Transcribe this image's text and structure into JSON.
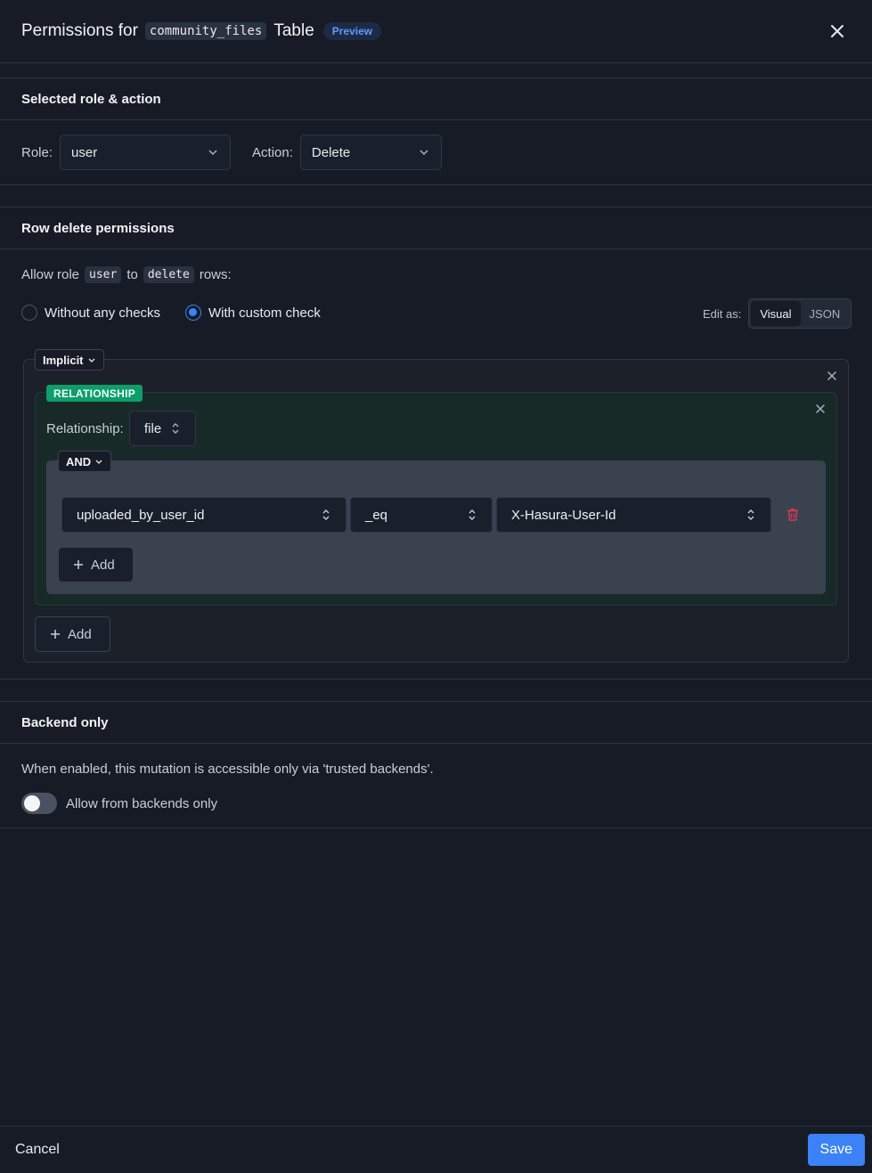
{
  "header": {
    "title_prefix": "Permissions for",
    "table_name": "community_files",
    "title_suffix": "Table",
    "badge": "Preview"
  },
  "role_section": {
    "title": "Selected role & action",
    "role_label": "Role:",
    "role_value": "user",
    "action_label": "Action:",
    "action_value": "Delete"
  },
  "row_section": {
    "title": "Row delete permissions",
    "allow_text_1": "Allow role",
    "allow_role": "user",
    "allow_text_2": "to",
    "allow_action": "delete",
    "allow_text_3": "rows:",
    "radio_no_checks": "Without any checks",
    "radio_custom": "With custom check",
    "selected_radio": "With custom check",
    "edit_as_label": "Edit as:",
    "edit_options": [
      "Visual",
      "JSON"
    ],
    "edit_selected": "Visual",
    "implicit_label": "Implicit",
    "relationship_badge": "RELATIONSHIP",
    "relationship_label": "Relationship:",
    "relationship_value": "file",
    "and_label": "AND",
    "condition": {
      "column": "uploaded_by_user_id",
      "operator": "_eq",
      "value": "X-Hasura-User-Id"
    },
    "inner_add": "Add",
    "outer_add": "Add"
  },
  "backend_section": {
    "title": "Backend only",
    "description": "When enabled, this mutation is accessible only via 'trusted backends'.",
    "toggle_label": "Allow from backends only",
    "toggle_on": false
  },
  "footer": {
    "cancel": "Cancel",
    "save": "Save"
  },
  "colors": {
    "accent": "#3b82f6",
    "relationship_badge": "#0f9d6b",
    "danger": "#e0364f"
  }
}
